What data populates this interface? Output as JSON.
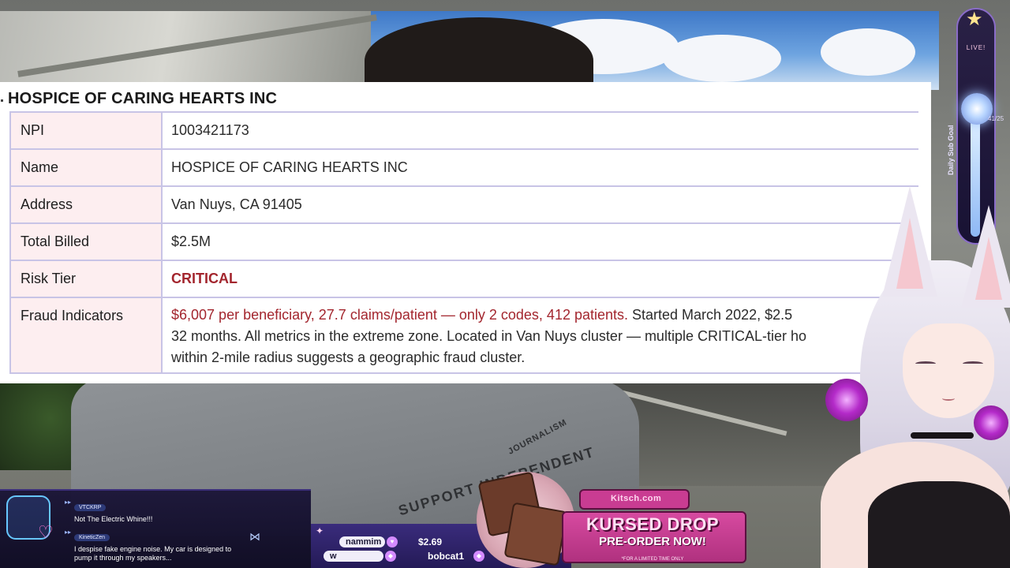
{
  "document": {
    "title": "HOSPICE OF CARING HEARTS INC",
    "rows": [
      {
        "label": "NPI",
        "value": "1003421173"
      },
      {
        "label": "Name",
        "value": "HOSPICE OF CARING HEARTS INC"
      },
      {
        "label": "Address",
        "value": "Van Nuys, CA 91405"
      },
      {
        "label": "Total Billed",
        "value": "$2.5M"
      },
      {
        "label": "Risk Tier",
        "value": "CRITICAL"
      },
      {
        "label": "Fraud Indicators",
        "highlight": "$6,007 per beneficiary, 27.7 claims/patient — only 2 codes, 412 patients.",
        "line1_rest": " Started March 2022, $2.5",
        "line2": "32 months. All metrics in the extreme zone. Located in Van Nuys cluster — multiple CRITICAL-tier ho",
        "line3": "within 2-mile radius suggests a geographic fraud cluster."
      }
    ],
    "colors": {
      "critical": "#a3262e",
      "label_bg": "#fdeef0",
      "border": "#c8c4e6"
    }
  },
  "goal": {
    "label": "Daily Sub Goal",
    "status": "LIVE!",
    "count": "41/25"
  },
  "shirt_text": "SUPPORT INDEPENDENT JOURNALISM",
  "chat": {
    "messages": [
      {
        "user": "VTCKRP",
        "text": "Not The Electric Whine!!!"
      },
      {
        "user": "KineticZen",
        "text": "I despise fake engine noise. My car is designed to pump it through my speakers..."
      }
    ]
  },
  "ticker": {
    "top_name": "nammim",
    "amount": "$2.69",
    "bottom_left": "w",
    "bottom_name": "bobcat1"
  },
  "promo": {
    "brand": "Kitsch.com",
    "headline": "KURSED DROP",
    "cta": "PRE-ORDER NOW!",
    "note": "*FOR A LIMITED TIME ONLY"
  }
}
